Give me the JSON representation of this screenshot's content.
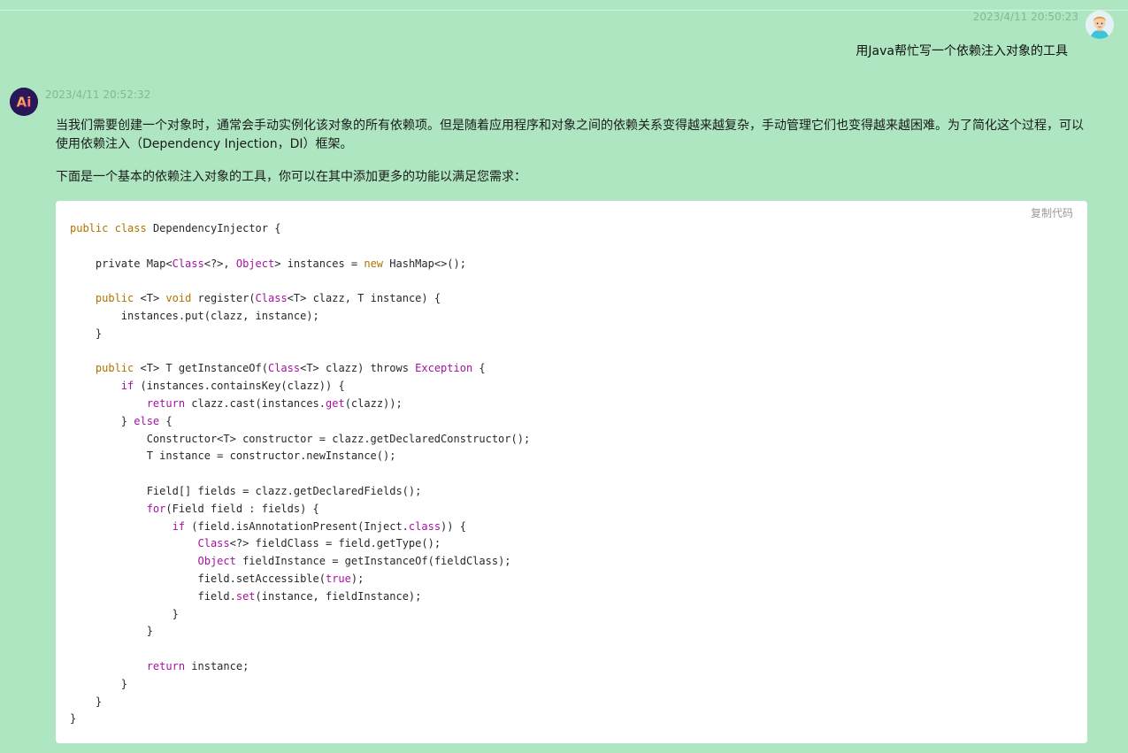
{
  "conversation": {
    "user": {
      "timestamp": "2023/4/11 20:50:23",
      "message": "用Java帮忙写一个依赖注入对象的工具",
      "avatar_icon": "user-avatar-icon"
    },
    "assistant": {
      "timestamp": "2023/4/11 20:52:32",
      "avatar_icon": "ai-logo-icon",
      "avatar_text": "Ai",
      "paragraph_1": "当我们需要创建一个对象时，通常会手动实例化该对象的所有依赖项。但是随着应用程序和对象之间的依赖关系变得越来越复杂，手动管理它们也变得越来越困难。为了简化这个过程，可以使用依赖注入（Dependency Injection，DI）框架。",
      "paragraph_2": "下面是一个基本的依赖注入对象的工具，你可以在其中添加更多的功能以满足您需求：",
      "code": {
        "copy_label": "复制代码",
        "language": "java",
        "lines": [
          [
            {
              "t": "public",
              "c": "kw"
            },
            {
              "t": " "
            },
            {
              "t": "class",
              "c": "kw"
            },
            {
              "t": " DependencyInjector {"
            }
          ],
          [],
          [
            {
              "t": "    private Map<"
            },
            {
              "t": "Class",
              "c": "type"
            },
            {
              "t": "<?>, "
            },
            {
              "t": "Object",
              "c": "type"
            },
            {
              "t": "> instances = "
            },
            {
              "t": "new",
              "c": "kw"
            },
            {
              "t": " HashMap<>();"
            }
          ],
          [],
          [
            {
              "t": "    "
            },
            {
              "t": "public",
              "c": "kw"
            },
            {
              "t": " <T> "
            },
            {
              "t": "void",
              "c": "kw"
            },
            {
              "t": " register("
            },
            {
              "t": "Class",
              "c": "type"
            },
            {
              "t": "<T> clazz, T instance) {"
            }
          ],
          [
            {
              "t": "        instances.put(clazz, instance);"
            }
          ],
          [
            {
              "t": "    }"
            }
          ],
          [],
          [
            {
              "t": "    "
            },
            {
              "t": "public",
              "c": "kw"
            },
            {
              "t": " <T> T getInstanceOf("
            },
            {
              "t": "Class",
              "c": "type"
            },
            {
              "t": "<T> clazz) throws "
            },
            {
              "t": "Exception",
              "c": "type"
            },
            {
              "t": " {"
            }
          ],
          [
            {
              "t": "        "
            },
            {
              "t": "if",
              "c": "type"
            },
            {
              "t": " (instances.containsKey(clazz)) {"
            }
          ],
          [
            {
              "t": "            "
            },
            {
              "t": "return",
              "c": "type"
            },
            {
              "t": " clazz.cast(instances."
            },
            {
              "t": "get",
              "c": "type"
            },
            {
              "t": "(clazz));"
            }
          ],
          [
            {
              "t": "        } "
            },
            {
              "t": "else",
              "c": "type"
            },
            {
              "t": " {"
            }
          ],
          [
            {
              "t": "            Constructor<T> constructor = clazz.getDeclaredConstructor();"
            }
          ],
          [
            {
              "t": "            T instance = constructor.newInstance();"
            }
          ],
          [],
          [
            {
              "t": "            Field[] fields = clazz.getDeclaredFields();"
            }
          ],
          [
            {
              "t": "            "
            },
            {
              "t": "for",
              "c": "type"
            },
            {
              "t": "(Field field : fields) {"
            }
          ],
          [
            {
              "t": "                "
            },
            {
              "t": "if",
              "c": "type"
            },
            {
              "t": " (field.isAnnotationPresent(Inject."
            },
            {
              "t": "class",
              "c": "type"
            },
            {
              "t": ")) {"
            }
          ],
          [
            {
              "t": "                    "
            },
            {
              "t": "Class",
              "c": "type"
            },
            {
              "t": "<?> fieldClass = field.getType();"
            }
          ],
          [
            {
              "t": "                    "
            },
            {
              "t": "Object",
              "c": "type"
            },
            {
              "t": " fieldInstance = getInstanceOf(fieldClass);"
            }
          ],
          [
            {
              "t": "                    field.setAccessible("
            },
            {
              "t": "true",
              "c": "type"
            },
            {
              "t": ");"
            }
          ],
          [
            {
              "t": "                    field."
            },
            {
              "t": "set",
              "c": "type"
            },
            {
              "t": "(instance, fieldInstance);"
            }
          ],
          [
            {
              "t": "                }"
            }
          ],
          [
            {
              "t": "            }"
            }
          ],
          [],
          [
            {
              "t": "            "
            },
            {
              "t": "return",
              "c": "type"
            },
            {
              "t": " instance;"
            }
          ],
          [
            {
              "t": "        }"
            }
          ],
          [
            {
              "t": "    }"
            }
          ],
          [
            {
              "t": "}"
            }
          ]
        ]
      }
    }
  },
  "colors": {
    "background": "#ade6c0",
    "keyword": "#b07300",
    "type_highlight": "#a3139f",
    "timestamp": "#7fbb96"
  }
}
